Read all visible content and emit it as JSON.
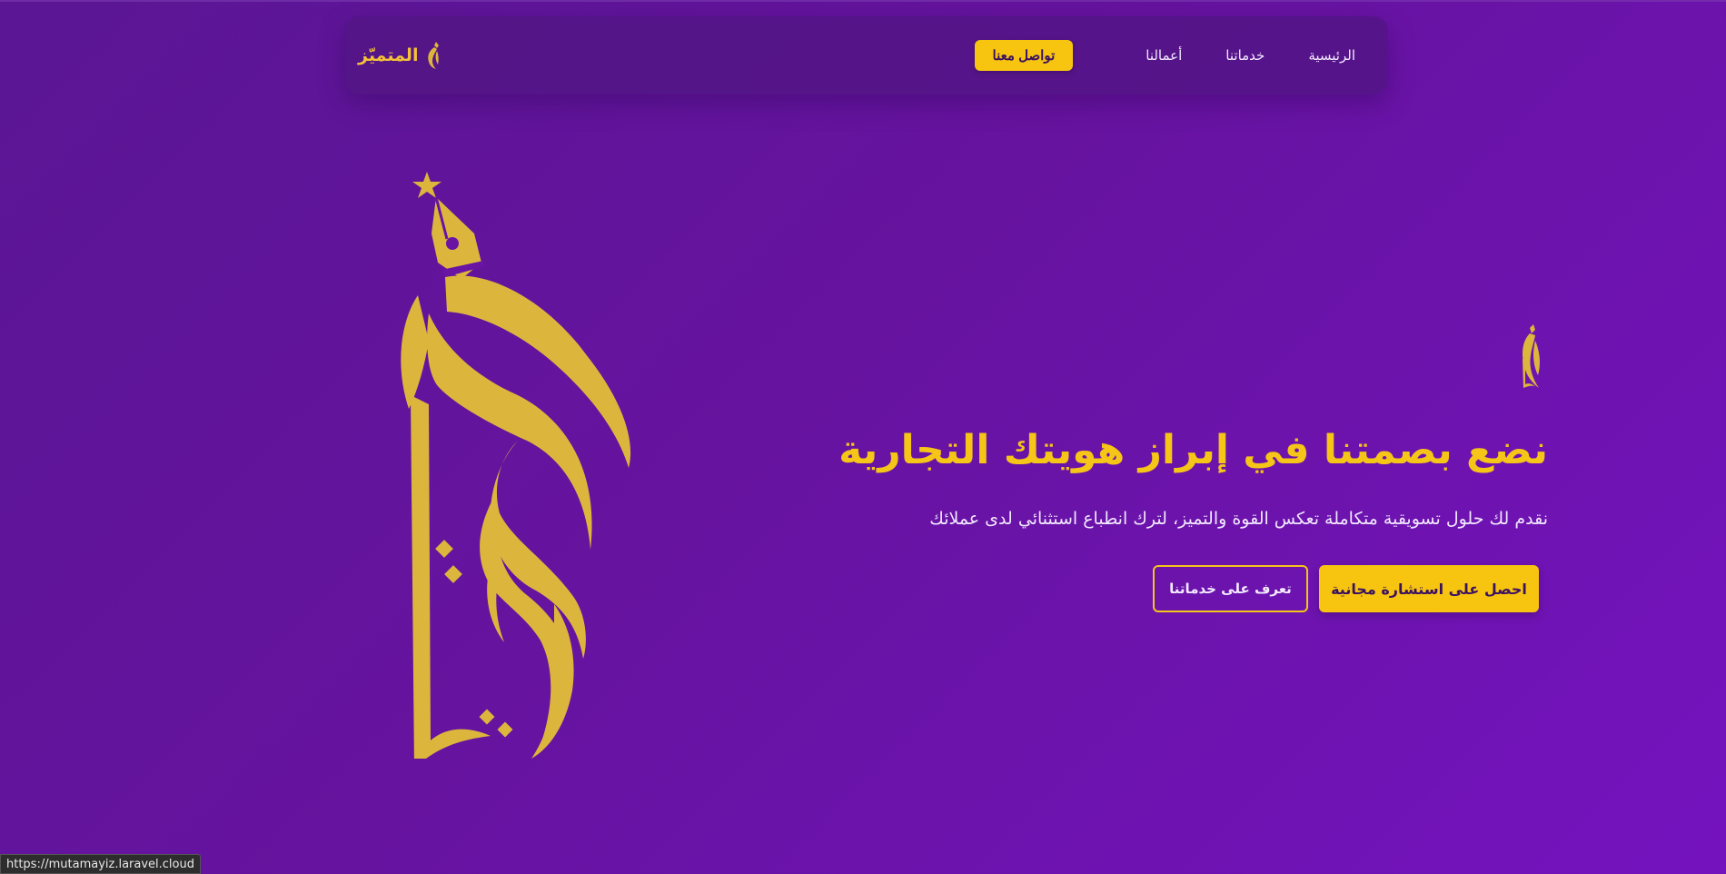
{
  "brand": {
    "name": "المتميّز",
    "logo_icon": "calligraphy-pen-icon",
    "color": "#f3c237"
  },
  "nav": {
    "links": [
      "الرئيسية",
      "خدماتنا",
      "أعمالنا"
    ],
    "cta": "تواصل معنا"
  },
  "hero": {
    "title": "نضع بصمتنا في إبراز هويتك التجارية",
    "subtitle": "نقدم لك حلول تسويقية متكاملة تعكس القوة والتميز، لترك انطباع استثنائي لدى عملائك",
    "primary_button": "احصل على استشارة مجانية",
    "secondary_button": "تعرف على خدماتنا",
    "emblem_icon": "calligraphy-emblem-icon",
    "art_icon": "calligraphy-pen-logo-icon"
  },
  "status_bar": {
    "url": "https://mutamayiz.laravel.cloud"
  },
  "colors": {
    "accent": "#f5c518",
    "background": "#66139f",
    "gold_art": "#dcb63c"
  }
}
